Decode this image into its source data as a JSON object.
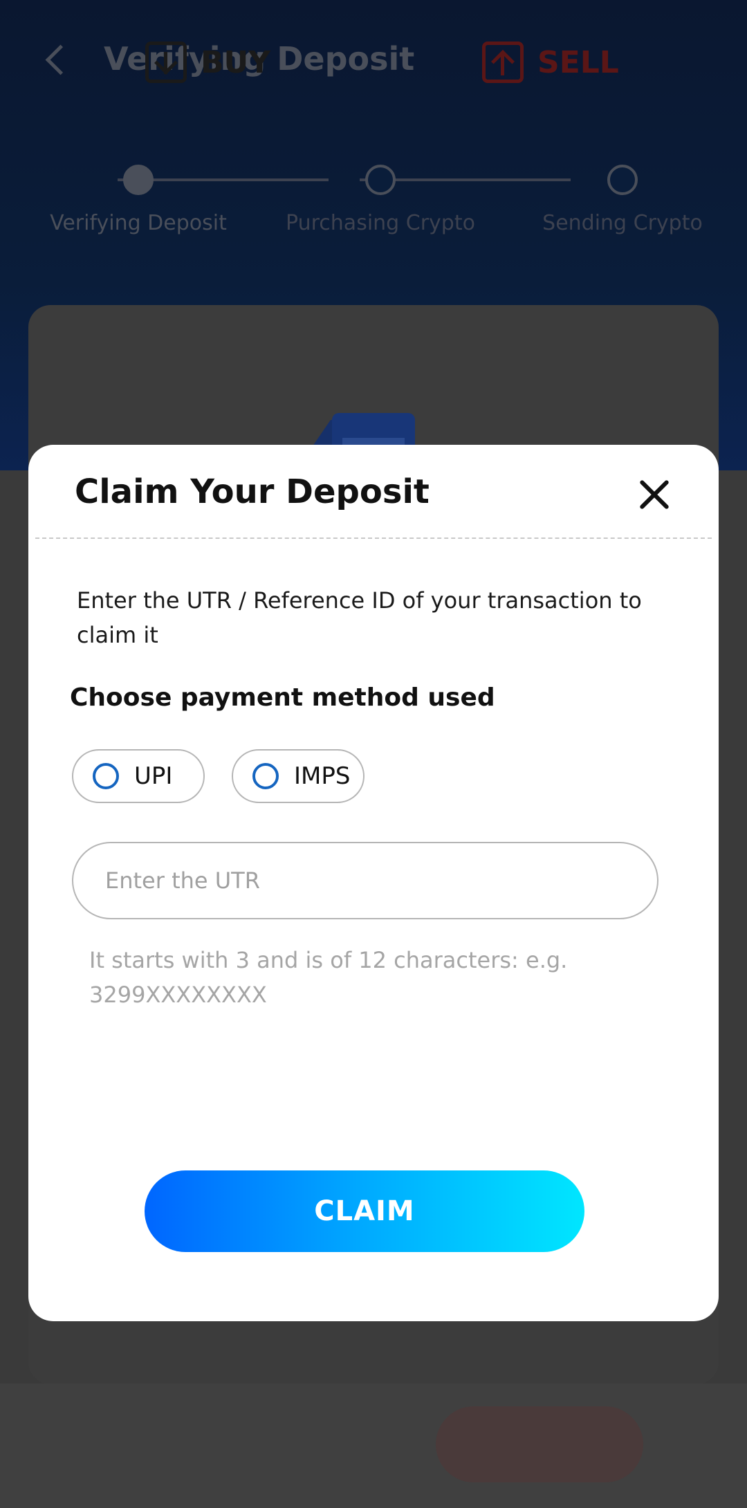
{
  "header": {
    "title": "Verifying Deposit"
  },
  "stepper": {
    "steps": [
      {
        "label": "Verifying Deposit"
      },
      {
        "label": "Purchasing Crypto"
      },
      {
        "label": "Sending Crypto"
      }
    ],
    "active_index": 0
  },
  "modal": {
    "title": "Claim Your Deposit",
    "description": "Enter the UTR / Reference ID of your transaction to claim it",
    "payment_section_label": "Choose payment method used",
    "payment_options": [
      {
        "label": "UPI",
        "selected": false
      },
      {
        "label": "IMPS",
        "selected": false
      }
    ],
    "utr_input": {
      "value": "",
      "placeholder": "Enter the UTR"
    },
    "hint": "It starts with 3 and is of 12 characters: e.g. 3299XXXXXXXX",
    "claim_label": "CLAIM"
  },
  "bottom_bar": {
    "buy_label": "BUY",
    "sell_label": "SELL"
  },
  "colors": {
    "accent_blue": "#1565c0",
    "claim_gradient_start": "#0066ff",
    "claim_gradient_end": "#00e6ff",
    "sell_red": "#5b1616"
  },
  "icons": {
    "back": "back-arrow-icon",
    "close": "close-icon",
    "buy": "download-arrow-icon",
    "sell": "upload-arrow-icon"
  }
}
